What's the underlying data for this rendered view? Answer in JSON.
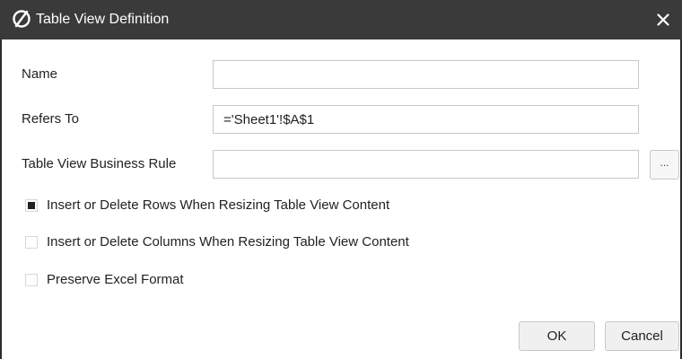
{
  "window": {
    "title": "Table View Definition",
    "logo_icon": "oracle-smart-view-icon",
    "close_icon": "close-icon"
  },
  "form": {
    "name": {
      "label": "Name",
      "value": ""
    },
    "refers_to": {
      "label": "Refers To",
      "value": "='Sheet1'!$A$1"
    },
    "business_rule": {
      "label": "Table View Business Rule",
      "value": "",
      "browse_label": "..."
    }
  },
  "options": [
    {
      "label": "Insert or Delete Rows When Resizing Table View Content",
      "checked": true
    },
    {
      "label": "Insert or Delete Columns When Resizing Table View Content",
      "checked": false
    },
    {
      "label": "Preserve Excel Format",
      "checked": false
    }
  ],
  "buttons": {
    "ok": "OK",
    "cancel": "Cancel"
  },
  "colors": {
    "titlebar": "#3a3a3a",
    "title_text": "#ffffff",
    "checkbox_fill": "#222222"
  }
}
